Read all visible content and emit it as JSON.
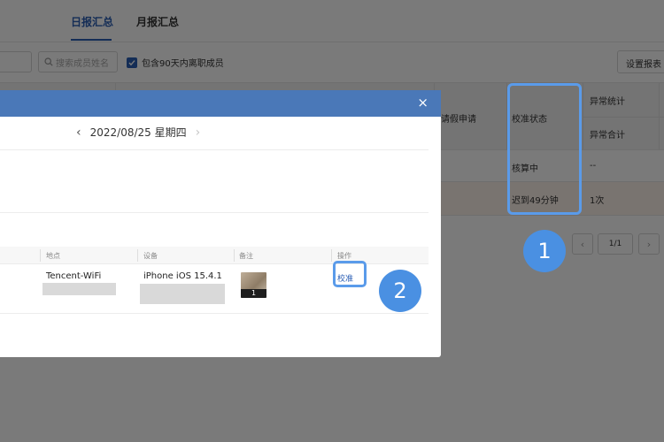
{
  "tabs": {
    "daily": "日报汇总",
    "monthly": "月报汇总"
  },
  "filters": {
    "search_placeholder": "搜索成员姓名",
    "include_resigned_label": "包含90天内离职成员",
    "settings_button": "设置报表"
  },
  "table": {
    "header": {
      "leave_request": "请假申请",
      "calib_status": "校准状态",
      "abnormal_stats": "异常统计",
      "abnormal_total": "异常合计"
    },
    "rows": [
      {
        "calib_status": "核算中",
        "abnormal": "--"
      },
      {
        "calib_status": "迟到49分钟",
        "abnormal": "1次"
      }
    ]
  },
  "pagination": {
    "prev": "‹",
    "page": "1/1",
    "next": "›"
  },
  "badges": {
    "one": "1",
    "two": "2"
  },
  "modal": {
    "close": "×",
    "date": "2022/08/25 星期四",
    "prev": "‹",
    "next": "›",
    "record_headers": {
      "location": "地点",
      "device": "设备",
      "note": "备注",
      "action": "操作"
    },
    "record": {
      "location": "Tencent-WiFi",
      "device": "iPhone iOS 15.4.1",
      "photo_count": "1",
      "action": "校准"
    }
  },
  "colors": {
    "accent": "#2b5fb5",
    "highlight": "#5a9bea",
    "badge": "#4a90e2",
    "modal_header": "#4a78b8"
  },
  "icons": {
    "search": "search-icon",
    "close": "close-icon",
    "check": "check-icon"
  }
}
